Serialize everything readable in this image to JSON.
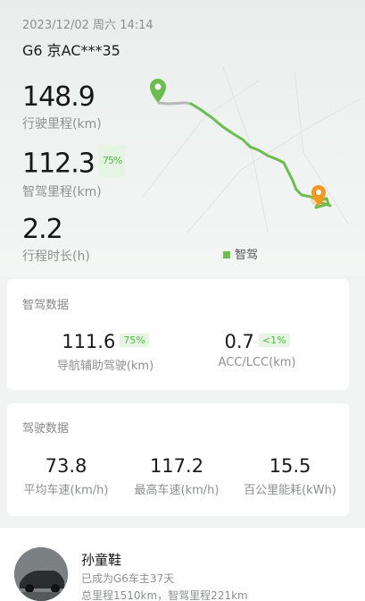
{
  "trip": {
    "datetime": "2023/12/02 周六 14:14",
    "plate": "G6 京AC***35",
    "distance_value": "148.9",
    "distance_label": "行驶里程(km)",
    "smart_value": "112.3",
    "smart_pct": "75%",
    "smart_label": "智驾里程(km)",
    "duration_value": "2.2",
    "duration_label": "行程时长(h)",
    "legend_label": "智驾"
  },
  "colors": {
    "route": "#6bbd4f",
    "route_gray": "#b5b8b7",
    "start_pin": "#6bbd4f",
    "end_pin": "#f39a1e"
  },
  "smart_drive": {
    "title": "智驾数据",
    "nav_value": "111.6",
    "nav_pct": "75%",
    "nav_label": "导航辅助驾驶(km)",
    "acc_value": "0.7",
    "acc_pct": "<1%",
    "acc_label": "ACC/LCC(km)"
  },
  "driving": {
    "title": "驾驶数据",
    "avg_speed": "73.8",
    "avg_speed_label": "平均车速(km/h)",
    "max_speed": "117.2",
    "max_speed_label": "最高车速(km/h)",
    "energy": "15.5",
    "energy_label": "百公里能耗(kWh)"
  },
  "owner": {
    "name": "孙童鞋",
    "since": "已成为G6车主37天",
    "totals": "总里程1510km，智驾里程221km"
  }
}
